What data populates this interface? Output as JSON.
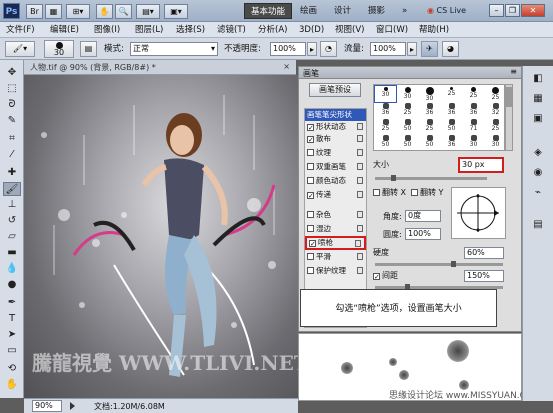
{
  "titlebar": {
    "app": "Ps",
    "workspaces": [
      "基本功能",
      "绘画",
      "设计",
      "摄影",
      "»"
    ],
    "active_workspace": "基本功能",
    "cs_live": "CS Live",
    "window_controls": [
      "minimize",
      "restore",
      "close"
    ]
  },
  "menubar": {
    "items": [
      "文件(F)",
      "编辑(E)",
      "图像(I)",
      "图层(L)",
      "选择(S)",
      "滤镜(T)",
      "分析(A)",
      "3D(D)",
      "视图(V)",
      "窗口(W)",
      "帮助(H)"
    ]
  },
  "options": {
    "brush_size": "30",
    "mode_label": "模式:",
    "mode_value": "正常",
    "opacity_label": "不透明度:",
    "opacity_value": "100%",
    "flow_label": "流量:",
    "flow_value": "100%"
  },
  "document": {
    "tab_title": "人物.tif @ 90% (背景, RGB/8#) *",
    "zoom": "90%",
    "doc_info": "文档:1.20M/6.08M",
    "watermark": "騰龍視覺  WWW.TLIVI.NET"
  },
  "brush_panel": {
    "title": "画笔",
    "preset_button": "画笔预设",
    "options": [
      {
        "label": "画笔笔尖形状",
        "checked": false,
        "selected": true,
        "has_checkbox": false
      },
      {
        "label": "形状动态",
        "checked": true,
        "selected": false,
        "has_checkbox": true
      },
      {
        "label": "散布",
        "checked": true,
        "selected": false,
        "has_checkbox": true
      },
      {
        "label": "纹理",
        "checked": false,
        "selected": false,
        "has_checkbox": true
      },
      {
        "label": "双重画笔",
        "checked": false,
        "selected": false,
        "has_checkbox": true
      },
      {
        "label": "颜色动态",
        "checked": false,
        "selected": false,
        "has_checkbox": true
      },
      {
        "label": "传递",
        "checked": true,
        "selected": false,
        "has_checkbox": true
      },
      {
        "label": "杂色",
        "checked": false,
        "selected": false,
        "has_checkbox": true
      },
      {
        "label": "湿边",
        "checked": false,
        "selected": false,
        "has_checkbox": true
      },
      {
        "label": "喷枪",
        "checked": true,
        "selected": false,
        "has_checkbox": true
      },
      {
        "label": "平滑",
        "checked": false,
        "selected": false,
        "has_checkbox": true
      },
      {
        "label": "保护纹理",
        "checked": false,
        "selected": false,
        "has_checkbox": true
      }
    ],
    "tip_sizes": [
      "30",
      "30",
      "30",
      "25",
      "25",
      "25",
      "36",
      "25",
      "36",
      "36",
      "36",
      "32",
      "25",
      "50",
      "25",
      "50",
      "71",
      "25",
      "50",
      "50",
      "50",
      "36",
      "30",
      "30"
    ],
    "size_label": "大小",
    "size_value": "30 px",
    "flip_x": "翻转 X",
    "flip_y": "翻转 Y",
    "angle_label": "角度:",
    "angle_value": "0度",
    "roundness_label": "圆度:",
    "roundness_value": "100%",
    "hardness_label": "硬度",
    "hardness_value": "60%",
    "spacing_label": "间距",
    "spacing_value": "150%",
    "spacing_checked": true
  },
  "callout": {
    "text": "勾选“喷枪”选项，设置画笔大小"
  },
  "footer_watermark": "思缘设计论坛 www.MISSYUAN.COM",
  "colors": {
    "highlight": "#3058b8",
    "callout_border": "#d31d1d"
  }
}
